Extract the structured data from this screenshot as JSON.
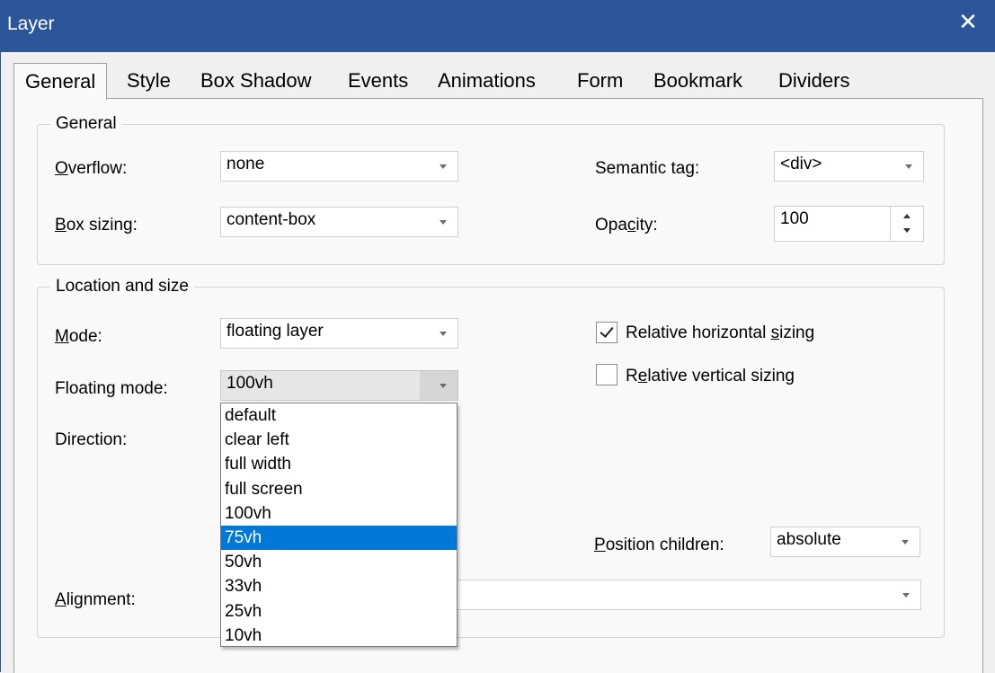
{
  "window": {
    "title": "Layer"
  },
  "tabs": [
    "General",
    "Style",
    "Box Shadow",
    "Events",
    "Animations",
    "Form",
    "Bookmark",
    "Dividers"
  ],
  "general_group": {
    "title": "General",
    "overflow": {
      "label_u": "O",
      "label_rest": "verflow:",
      "value": "none"
    },
    "box_sizing": {
      "label_u": "B",
      "label_rest": "ox sizing:",
      "value": "content-box"
    },
    "semantic_tag": {
      "label": "Semantic tag:",
      "value": "<div>"
    },
    "opacity": {
      "label_pre": "Opa",
      "label_u": "c",
      "label_post": "ity:",
      "value": "100"
    }
  },
  "location_group": {
    "title": "Location and size",
    "mode": {
      "label_u": "M",
      "label_rest": "ode:",
      "value": "floating layer"
    },
    "floating_mode": {
      "label": "Floating mode:",
      "value": "100vh"
    },
    "direction": {
      "label": "Direction:"
    },
    "alignment": {
      "label_u": "A",
      "label_rest": "lignment:",
      "value": ""
    },
    "relative_horizontal": {
      "label_pre": "Relative horizontal ",
      "label_u": "s",
      "label_post": "izing",
      "checked": true
    },
    "relative_vertical": {
      "label_pre": "R",
      "label_u": "e",
      "label_post": "lative vertical sizing",
      "checked": false
    },
    "position_children": {
      "label_u": "P",
      "label_rest": "osition children:",
      "value": "absolute"
    }
  },
  "floating_dropdown": {
    "options": [
      "default",
      "clear left",
      "full width",
      "full screen",
      "100vh",
      "75vh",
      "50vh",
      "33vh",
      "25vh",
      "10vh"
    ],
    "selected_index": 5
  },
  "colors": {
    "titlebar": "#2b579a",
    "selection": "#0078d7"
  }
}
